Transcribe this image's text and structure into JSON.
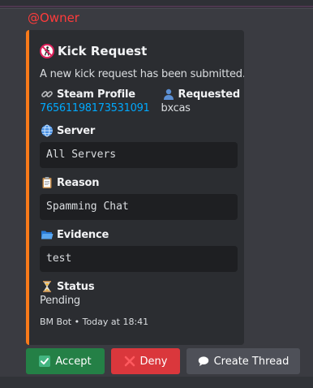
{
  "mention": "@Owner",
  "embed": {
    "accent_color": "#f97a1a",
    "title": "Kick Request",
    "title_icon": "no-pedestrians-icon",
    "description": "A new kick request has been submitted.",
    "steam_profile": {
      "icon": "link-icon",
      "label": "Steam Profile",
      "value": "76561198173531091"
    },
    "requested_by": {
      "icon": "bust-silhouette-icon",
      "label": "Requested By",
      "value": "bxcas"
    },
    "server": {
      "icon": "globe-icon",
      "label": "Server",
      "value": "All Servers"
    },
    "reason": {
      "icon": "clipboard-icon",
      "label": "Reason",
      "value": "Spamming Chat"
    },
    "evidence": {
      "icon": "open-folder-icon",
      "label": "Evidence",
      "value": "test"
    },
    "status": {
      "icon": "hourglass-icon",
      "label": "Status",
      "value": "Pending"
    },
    "footer": "BM Bot • Today at 18:41"
  },
  "buttons": {
    "accept": {
      "label": "Accept",
      "icon": "check-mark-icon",
      "color": "#248046"
    },
    "deny": {
      "label": "Deny",
      "icon": "cross-mark-icon",
      "color": "#da373c"
    },
    "thread": {
      "label": "Create Thread",
      "icon": "speech-bubble-icon",
      "color": "#4e5058"
    }
  }
}
